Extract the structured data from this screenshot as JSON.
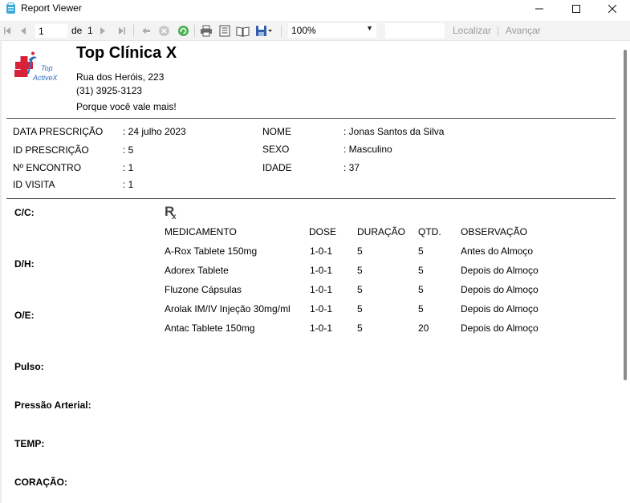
{
  "window": {
    "title": "Report Viewer",
    "minimize": "—",
    "maximize": "☐",
    "close": "✕"
  },
  "toolbar": {
    "page_current": "1",
    "page_of_label": "de",
    "page_total": "1",
    "zoom": "100%",
    "search_value": "",
    "find_label": "Localizar",
    "divider": "|",
    "next_label": "Avançar"
  },
  "clinic": {
    "name": "Top Clínica X",
    "address": "Rua dos Heróis, 223",
    "phone": "(31) 3925-3123",
    "slogan": "Porque você vale mais!",
    "logo_text_1": "Top",
    "logo_text_2": "ActiveX"
  },
  "info": {
    "left": [
      {
        "label": "DATA PRESCRIÇÃO",
        "value": ": 24 julho 2023"
      },
      {
        "label": "ID PRESCRIÇÃO",
        "value": ": 5"
      },
      {
        "label": "Nº ENCONTRO",
        "value": ": 1"
      },
      {
        "label": "ID VISITA",
        "value": ": 1"
      }
    ],
    "right": [
      {
        "label": "NOME",
        "value": ": Jonas Santos da Silva"
      },
      {
        "label": "SEXO",
        "value": ": Masculino"
      },
      {
        "label": "IDADE",
        "value": ": 37"
      }
    ]
  },
  "sections": [
    "C/C:",
    "D/H:",
    "O/E:",
    "Pulso:",
    "Pressão Arterial:",
    "TEMP:",
    "CORAÇÃO:"
  ],
  "rx_symbol": "R",
  "rx_sub": "x",
  "table": {
    "headers": [
      "MEDICAMENTO",
      "DOSE",
      "DURAÇÃO",
      "QTD.",
      "OBSERVAÇÃO"
    ],
    "rows": [
      [
        "A-Rox Tablete 150mg",
        "1-0-1",
        "5",
        "5",
        "Antes do Almoço"
      ],
      [
        "Adorex Tablete",
        "1-0-1",
        "5",
        "5",
        "Depois do Almoço"
      ],
      [
        "Fluzone Cápsulas",
        "1-0-1",
        "5",
        "5",
        "Depois do Almoço"
      ],
      [
        "Arolak IM/IV Injeção 30mg/ml",
        "1-0-1",
        "5",
        "5",
        "Depois do Almoço"
      ],
      [
        "Antac Tablete 150mg",
        "1-0-1",
        "5",
        "20",
        "Depois do Almoço"
      ]
    ]
  },
  "icons": {
    "first": "first-page-icon",
    "prev": "previous-page-icon",
    "next": "next-page-icon",
    "last": "last-page-icon",
    "back": "back-icon",
    "stop": "stop-icon",
    "refresh": "refresh-icon",
    "print": "print-icon",
    "print_layout": "print-layout-icon",
    "page_setup": "page-setup-icon",
    "export": "export-icon"
  }
}
